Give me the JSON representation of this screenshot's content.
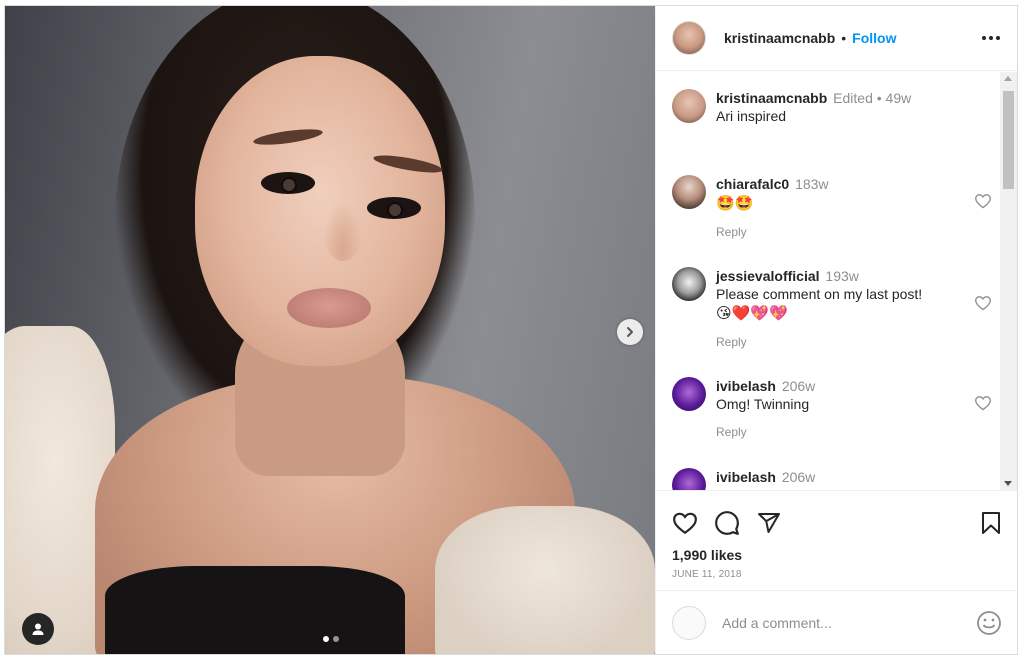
{
  "post": {
    "author": "kristinaamcnabb",
    "separator": "•",
    "follow_label": "Follow",
    "caption": {
      "username": "kristinaamcnabb",
      "meta": "Edited • 49w",
      "text": "Ari inspired"
    }
  },
  "comments": [
    {
      "username": "chiarafalc0",
      "time": "183w",
      "text": "🤩🤩",
      "reply_label": "Reply"
    },
    {
      "username": "jessievalofficial",
      "time": "193w",
      "text": "Please comment on my last post!",
      "emoji": "😘❤️💖💖",
      "reply_label": "Reply"
    },
    {
      "username": "ivibelash",
      "time": "206w",
      "text": "Omg! Twinning",
      "reply_label": "Reply"
    },
    {
      "username": "ivibelash",
      "time": "206w",
      "text": ""
    }
  ],
  "actions": {
    "likes": "1,990 likes",
    "date": "JUNE 11, 2018"
  },
  "add_comment": {
    "placeholder": "Add a comment..."
  },
  "carousel": {
    "slides": 2,
    "active": 1
  },
  "colors": {
    "accent": "#0095f6",
    "muted": "#8e8e8e",
    "text": "#262626"
  },
  "icons": [
    "more-icon",
    "heart-icon",
    "comment-icon",
    "share-icon",
    "bookmark-icon",
    "smiley-icon",
    "chevron-right-icon",
    "user-tag-icon"
  ]
}
